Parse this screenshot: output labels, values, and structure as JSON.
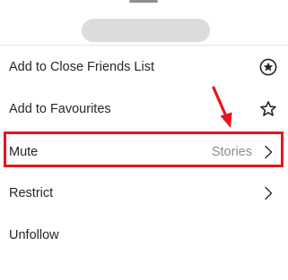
{
  "menu": {
    "items": [
      {
        "label": "Add to Close Friends List",
        "icon": "star-circle-icon"
      },
      {
        "label": "Add to Favourites",
        "icon": "star-outline-icon"
      },
      {
        "label": "Mute",
        "value": "Stories",
        "icon": "chevron-right-icon"
      },
      {
        "label": "Restrict",
        "icon": "chevron-right-icon"
      },
      {
        "label": "Unfollow"
      }
    ]
  },
  "annotation": {
    "color": "#e8141f",
    "highlighted_item": "Mute"
  }
}
